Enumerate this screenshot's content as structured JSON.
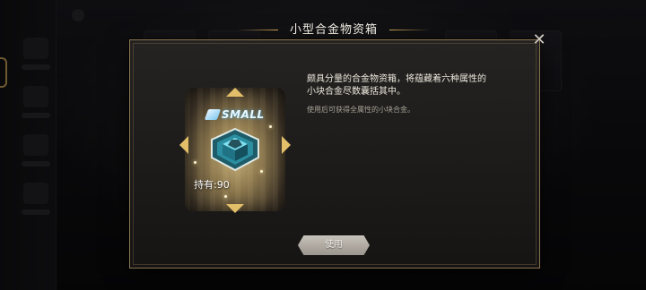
{
  "dialog": {
    "title": "小型合金物资箱",
    "close_icon": "close-icon"
  },
  "item": {
    "size_tag": "SMALL",
    "quantity_text": "持有:90",
    "icon": "alloy-crystal-icon"
  },
  "description": {
    "main": "颇具分量的合金物资箱，将蕴藏着六种属性的小块合金尽数囊括其中。",
    "hint": "使用后可获得全属性的小块合金。"
  },
  "actions": {
    "use_label": "使用"
  },
  "colors": {
    "accent_gold": "#c9a257",
    "button_gray": "#b4afa7"
  }
}
